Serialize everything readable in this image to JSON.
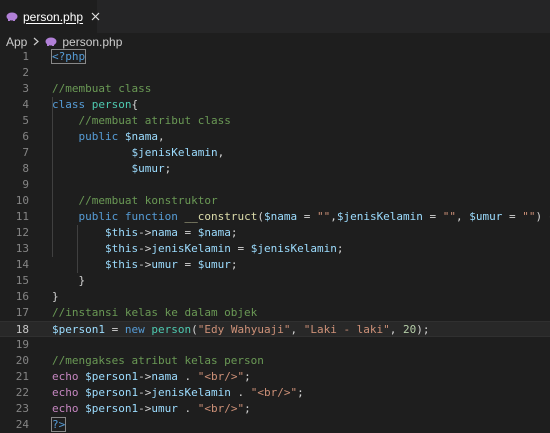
{
  "tab": {
    "label": "person.php",
    "icon": "php-elephant-icon",
    "close": "close-icon"
  },
  "breadcrumb": {
    "root": "App",
    "file": "person.php"
  },
  "colors": {
    "keyword": "#569cd6",
    "comment": "#6a9955",
    "variable": "#9cdcfe",
    "string": "#ce9178",
    "number": "#b5cea8",
    "function": "#dcdcaa",
    "class": "#4ec9b0",
    "php_icon": "#b180d7"
  },
  "editor": {
    "active_line": 18,
    "lines": [
      {
        "n": "1",
        "tokens": [
          [
            "tag",
            "<?php"
          ]
        ]
      },
      {
        "n": "2",
        "tokens": []
      },
      {
        "n": "3",
        "tokens": [
          [
            "cmt",
            "//membuat class"
          ]
        ]
      },
      {
        "n": "4",
        "tokens": [
          [
            "kw",
            "class "
          ],
          [
            "cls",
            "person"
          ],
          [
            "txt",
            "{"
          ]
        ]
      },
      {
        "n": "5",
        "tokens": [
          [
            "txt",
            "    "
          ],
          [
            "cmt",
            "//membuat atribut class"
          ]
        ]
      },
      {
        "n": "6",
        "tokens": [
          [
            "txt",
            "    "
          ],
          [
            "kw",
            "public "
          ],
          [
            "var",
            "$nama"
          ],
          [
            "txt",
            ","
          ]
        ]
      },
      {
        "n": "7",
        "tokens": [
          [
            "txt",
            "            "
          ],
          [
            "var",
            "$jenisKelamin"
          ],
          [
            "txt",
            ","
          ]
        ]
      },
      {
        "n": "8",
        "tokens": [
          [
            "txt",
            "            "
          ],
          [
            "var",
            "$umur"
          ],
          [
            "txt",
            ";"
          ]
        ]
      },
      {
        "n": "9",
        "tokens": []
      },
      {
        "n": "10",
        "tokens": [
          [
            "txt",
            "    "
          ],
          [
            "cmt",
            "//membuat konstruktor"
          ]
        ]
      },
      {
        "n": "11",
        "tokens": [
          [
            "txt",
            "    "
          ],
          [
            "kw",
            "public function "
          ],
          [
            "fn",
            "__construct"
          ],
          [
            "txt",
            "("
          ],
          [
            "var",
            "$nama"
          ],
          [
            "txt",
            " = "
          ],
          [
            "str",
            "\"\""
          ],
          [
            "txt",
            ","
          ],
          [
            "var",
            "$jenisKelamin"
          ],
          [
            "txt",
            " = "
          ],
          [
            "str",
            "\"\""
          ],
          [
            "txt",
            ", "
          ],
          [
            "var",
            "$umur"
          ],
          [
            "txt",
            " = "
          ],
          [
            "str",
            "\"\""
          ],
          [
            "txt",
            ") {"
          ]
        ]
      },
      {
        "n": "12",
        "tokens": [
          [
            "txt",
            "        "
          ],
          [
            "var",
            "$this"
          ],
          [
            "txt",
            "->"
          ],
          [
            "var",
            "nama"
          ],
          [
            "txt",
            " = "
          ],
          [
            "var",
            "$nama"
          ],
          [
            "txt",
            ";"
          ]
        ]
      },
      {
        "n": "13",
        "tokens": [
          [
            "txt",
            "        "
          ],
          [
            "var",
            "$this"
          ],
          [
            "txt",
            "->"
          ],
          [
            "var",
            "jenisKelamin"
          ],
          [
            "txt",
            " = "
          ],
          [
            "var",
            "$jenisKelamin"
          ],
          [
            "txt",
            ";"
          ]
        ]
      },
      {
        "n": "14",
        "tokens": [
          [
            "txt",
            "        "
          ],
          [
            "var",
            "$this"
          ],
          [
            "txt",
            "->"
          ],
          [
            "var",
            "umur"
          ],
          [
            "txt",
            " = "
          ],
          [
            "var",
            "$umur"
          ],
          [
            "txt",
            ";"
          ]
        ]
      },
      {
        "n": "15",
        "tokens": [
          [
            "txt",
            "    }"
          ]
        ]
      },
      {
        "n": "16",
        "tokens": [
          [
            "txt",
            "}"
          ]
        ]
      },
      {
        "n": "17",
        "tokens": [
          [
            "cmt",
            "//instansi kelas ke dalam objek"
          ]
        ]
      },
      {
        "n": "18",
        "tokens": [
          [
            "var",
            "$person1"
          ],
          [
            "txt",
            " = "
          ],
          [
            "kw",
            "new "
          ],
          [
            "cls",
            "person"
          ],
          [
            "txt",
            "("
          ],
          [
            "str",
            "\"Edy Wahyuaji\""
          ],
          [
            "txt",
            ", "
          ],
          [
            "str",
            "\"Laki - laki\""
          ],
          [
            "txt",
            ", "
          ],
          [
            "num",
            "20"
          ],
          [
            "txt",
            ");"
          ]
        ]
      },
      {
        "n": "19",
        "tokens": []
      },
      {
        "n": "20",
        "tokens": [
          [
            "cmt",
            "//mengakses atribut kelas person"
          ]
        ]
      },
      {
        "n": "21",
        "tokens": [
          [
            "ctl",
            "echo "
          ],
          [
            "var",
            "$person1"
          ],
          [
            "txt",
            "->"
          ],
          [
            "var",
            "nama"
          ],
          [
            "txt",
            " . "
          ],
          [
            "str",
            "\"<br/>\""
          ],
          [
            "txt",
            ";"
          ]
        ]
      },
      {
        "n": "22",
        "tokens": [
          [
            "ctl",
            "echo "
          ],
          [
            "var",
            "$person1"
          ],
          [
            "txt",
            "->"
          ],
          [
            "var",
            "jenisKelamin"
          ],
          [
            "txt",
            " . "
          ],
          [
            "str",
            "\"<br/>\""
          ],
          [
            "txt",
            ";"
          ]
        ]
      },
      {
        "n": "23",
        "tokens": [
          [
            "ctl",
            "echo "
          ],
          [
            "var",
            "$person1"
          ],
          [
            "txt",
            "->"
          ],
          [
            "var",
            "umur"
          ],
          [
            "txt",
            " . "
          ],
          [
            "str",
            "\"<br/>\""
          ],
          [
            "txt",
            ";"
          ]
        ]
      },
      {
        "n": "24",
        "tokens": [
          [
            "tag",
            "?>"
          ]
        ]
      }
    ]
  }
}
